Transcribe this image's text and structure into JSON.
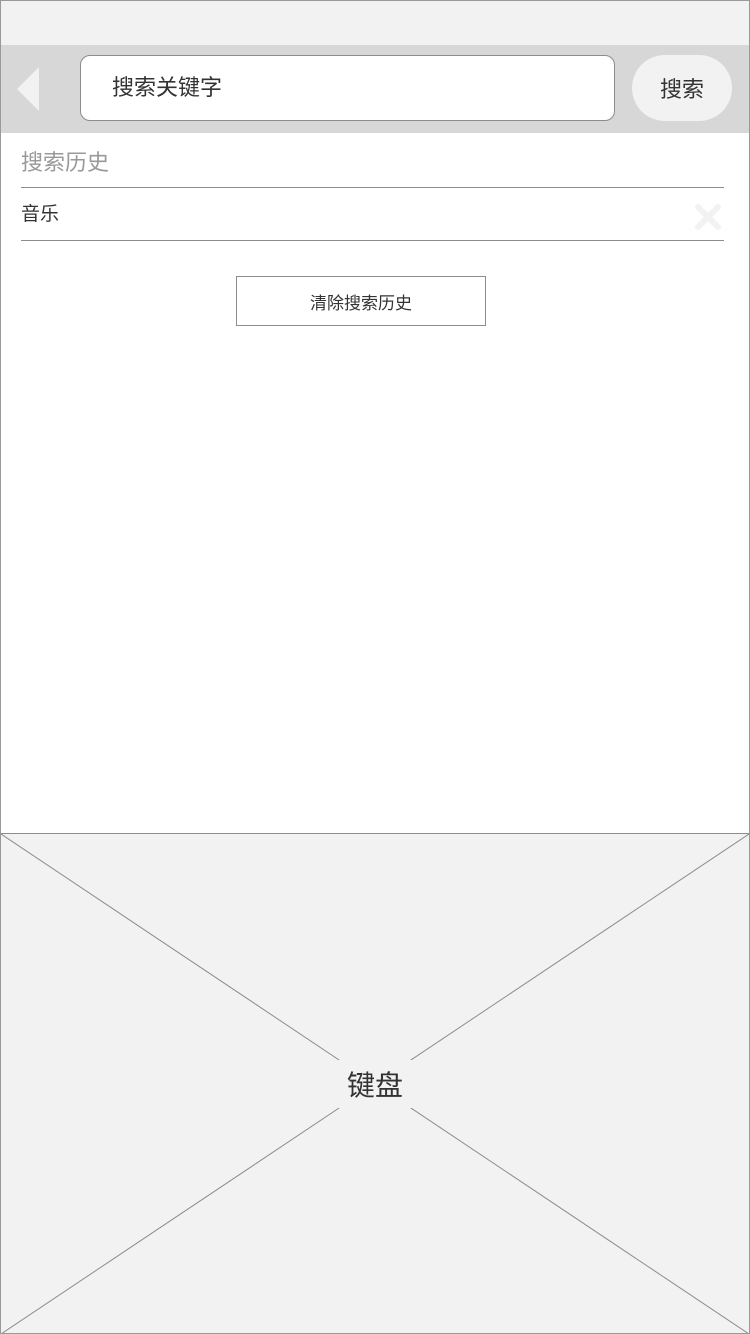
{
  "search_bar": {
    "placeholder": "搜索关键字",
    "search_label": "搜索"
  },
  "history": {
    "title": "搜索历史",
    "items": [
      {
        "label": "音乐"
      }
    ],
    "clear_label": "清除搜索历史"
  },
  "keyboard": {
    "label": "键盘"
  },
  "icons": {
    "back": "chevron-left-icon",
    "delete": "close-icon"
  },
  "colors": {
    "status_bar_bg": "#f2f2f2",
    "search_bar_bg": "#d7d7d7",
    "border": "#8c8c8c",
    "muted_text": "#999999",
    "text": "#333333",
    "icon_light": "#f2f2f2"
  }
}
